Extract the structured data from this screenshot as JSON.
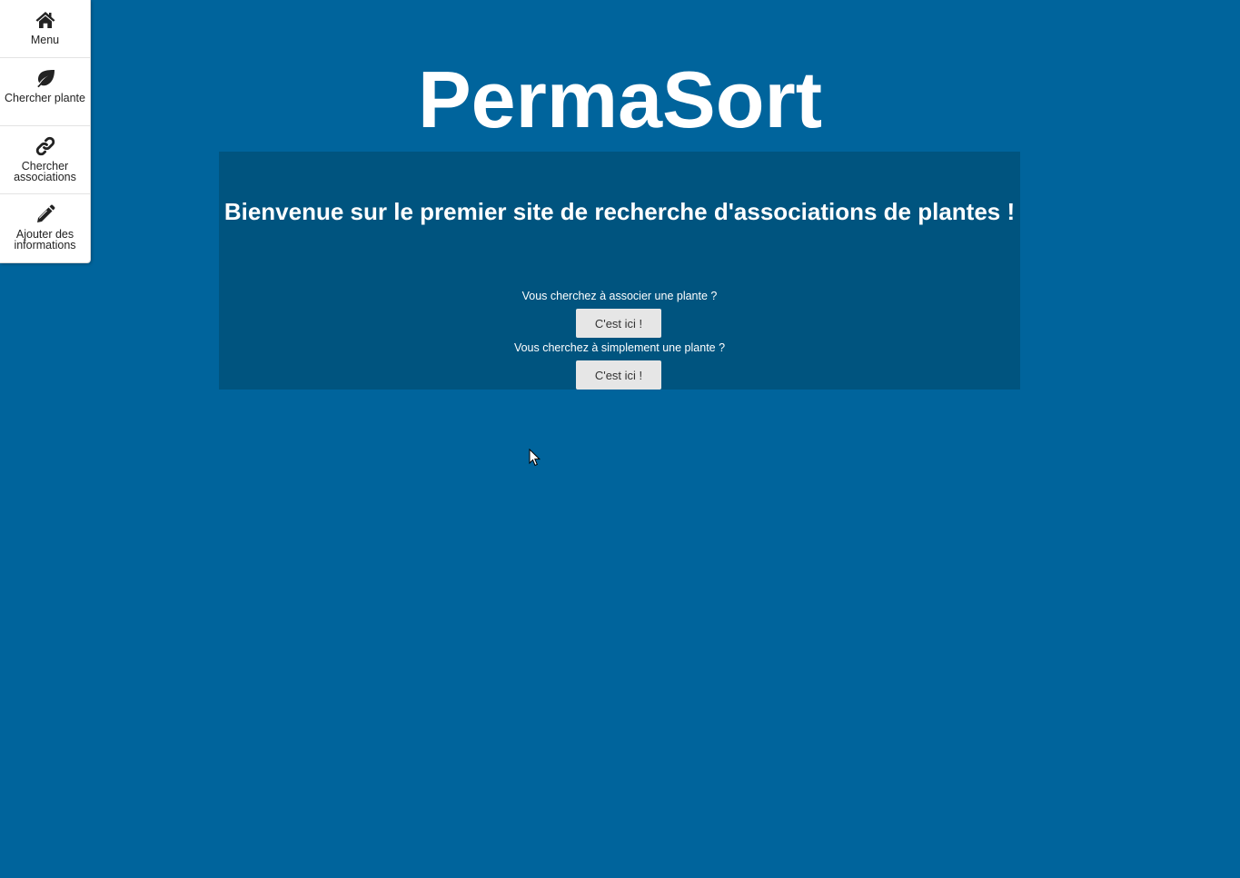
{
  "sidebar": {
    "items": [
      {
        "label": "Menu",
        "icon": "home-icon"
      },
      {
        "label": "Chercher plante",
        "icon": "leaf-icon"
      },
      {
        "label": "Chercher associations",
        "icon": "link-icon"
      },
      {
        "label": "Ajouter des informations",
        "icon": "pencil-icon"
      }
    ]
  },
  "header": {
    "title": "PermaSort"
  },
  "main": {
    "welcome": "Bienvenue sur le premier site de recherche d'associations de plantes !",
    "sections": [
      {
        "question": "Vous cherchez à associer une plante ?",
        "button_label": "C'est ici !"
      },
      {
        "question": "Vous cherchez à simplement une plante ?",
        "button_label": "C'est ici !"
      }
    ]
  },
  "colors": {
    "background": "#00649c",
    "panel": "#00547f",
    "button": "#e6e6e6",
    "text": "#ffffff"
  }
}
